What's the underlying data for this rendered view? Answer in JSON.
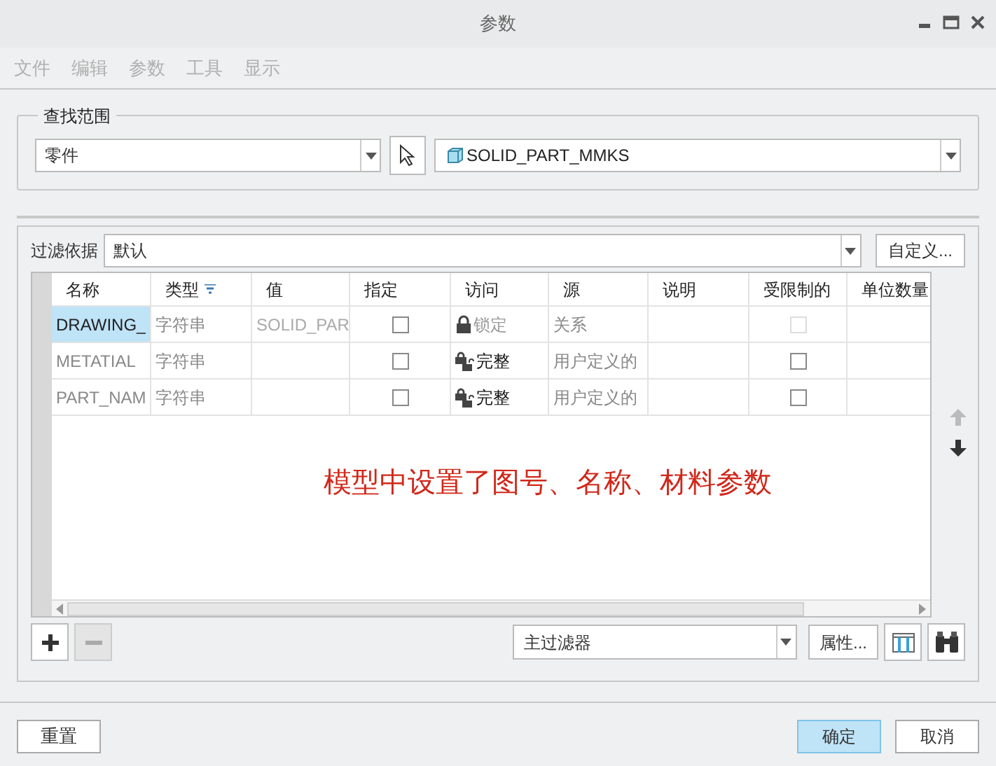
{
  "window": {
    "title": "参数"
  },
  "menu": [
    "文件",
    "编辑",
    "参数",
    "工具",
    "显示"
  ],
  "find_scope": {
    "legend": "查找范围",
    "type_value": "零件",
    "model_value": "SOLID_PART_MMKS"
  },
  "filter": {
    "label": "过滤依据",
    "value": "默认",
    "customize_button": "自定义..."
  },
  "table": {
    "columns": [
      "名称",
      "类型",
      "值",
      "指定",
      "访问",
      "源",
      "说明",
      "受限制的",
      "单位数量"
    ],
    "rows": [
      {
        "name": "DRAWING_",
        "type": "字符串",
        "value": "SOLID_PAR",
        "designated": false,
        "kind": "locked",
        "access": "锁定",
        "source": "关系",
        "restricted": false,
        "restricted_disabled": true,
        "selected": true
      },
      {
        "name": "METATIAL",
        "type": "字符串",
        "designated": false,
        "kind": "full",
        "access": "完整",
        "source": "用户定义的",
        "restricted": false,
        "restricted_disabled": false,
        "selected": false
      },
      {
        "name": "PART_NAM",
        "type": "字符串",
        "designated": false,
        "kind": "full",
        "access": "完整",
        "source": "用户定义的",
        "restricted": false,
        "restricted_disabled": false,
        "selected": false
      }
    ]
  },
  "annotation": "模型中设置了图号、名称、材料参数",
  "bottom_bar": {
    "filter_value": "主过滤器",
    "properties_button": "属性..."
  },
  "buttons": {
    "reset": "重置",
    "ok": "确定",
    "cancel": "取消"
  }
}
